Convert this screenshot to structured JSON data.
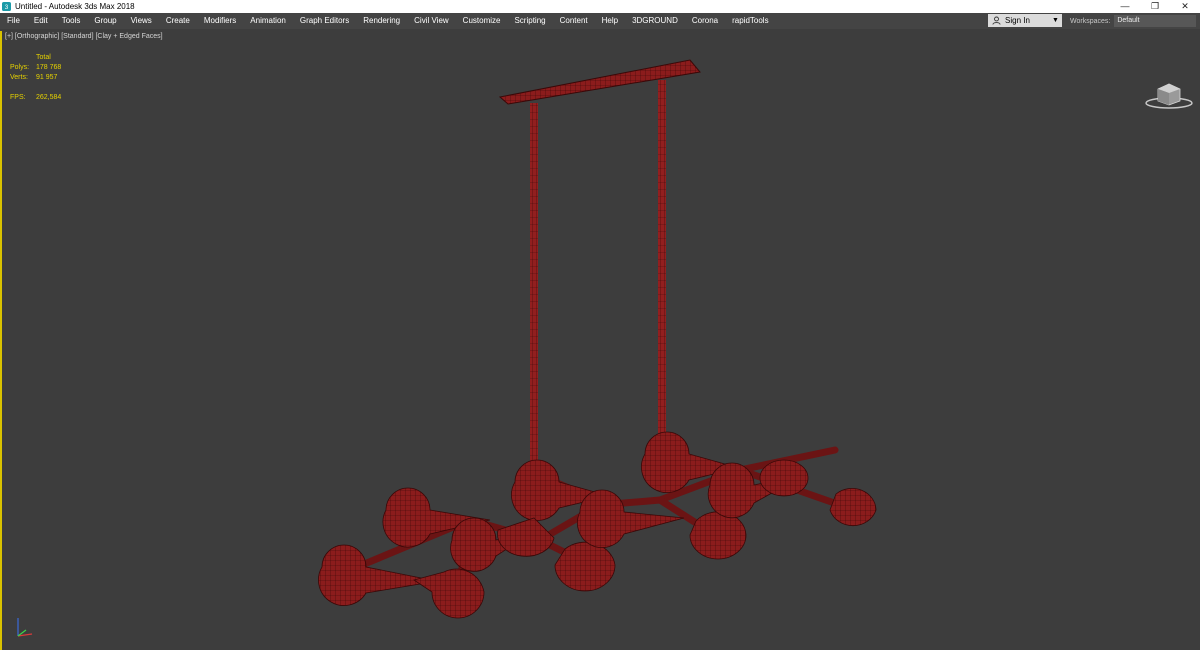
{
  "window": {
    "title": "Untitled - Autodesk 3ds Max 2018",
    "app_icon": "3dsmax-logo-icon",
    "controls": {
      "minimize": "—",
      "restore": "❐",
      "close": "✕"
    }
  },
  "menu": {
    "items": [
      "File",
      "Edit",
      "Tools",
      "Group",
      "Views",
      "Create",
      "Modifiers",
      "Animation",
      "Graph Editors",
      "Rendering",
      "Civil View",
      "Customize",
      "Scripting",
      "Content",
      "Help",
      "3DGROUND",
      "Corona",
      "rapidTools"
    ]
  },
  "account": {
    "sign_in": "Sign In",
    "icon": "user-icon"
  },
  "workspaces": {
    "label": "Workspaces:",
    "value": "Default"
  },
  "viewport": {
    "label": "[+] [Orthographic] [Standard] [Clay + Edged Faces]",
    "stats": {
      "header": "Total",
      "polys_label": "Polys:",
      "polys_value": "178 768",
      "verts_label": "Verts:",
      "verts_value": "91 957",
      "fps_label": "FPS:",
      "fps_value": "262,584"
    }
  },
  "colors": {
    "viewport_bg": "#3d3d3d",
    "model": "#8b1c1c",
    "model_edge": "#3a0808",
    "stats_text": "#e6d200",
    "active_border": "#d9c200"
  }
}
